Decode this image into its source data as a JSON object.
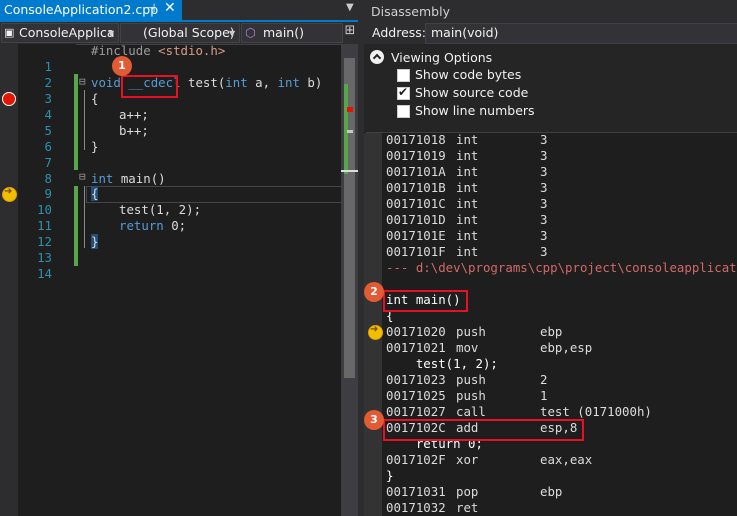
{
  "editor": {
    "tab_title": "ConsoleApplication2.cpp",
    "tab_pin": "⊣",
    "tab_close": "✕",
    "nav": {
      "project": "ConsoleApplica",
      "scope": "(Global Scope)",
      "member": "main()"
    },
    "lines": [
      {
        "n": "",
        "text": "#include <stdio.h>"
      },
      {
        "n": "1",
        "text": ""
      },
      {
        "n": "2",
        "text": ""
      },
      {
        "n": "3",
        "text": "void __cdecl test(int a, int b)"
      },
      {
        "n": "4",
        "text": "{"
      },
      {
        "n": "5",
        "text": "a++;"
      },
      {
        "n": "6",
        "text": "b++;"
      },
      {
        "n": "7",
        "text": "}"
      },
      {
        "n": "8",
        "text": ""
      },
      {
        "n": "9",
        "text": "int main()"
      },
      {
        "n": "10",
        "text": "{"
      },
      {
        "n": "11",
        "text": "test(1, 2);"
      },
      {
        "n": "12",
        "text": "return 0;"
      },
      {
        "n": "13",
        "text": "}"
      },
      {
        "n": "14",
        "text": ""
      }
    ],
    "code": {
      "include_kw": "#include",
      "include_file": "<stdio.h>",
      "void_kw": "void",
      "cdecl": "__cdecl",
      "test_sig": " test(",
      "int1": "int",
      "a": " a, ",
      "int2": "int",
      "b": " b)",
      "brace_open": "{",
      "a_inc": "a++;",
      "b_inc": "b++;",
      "brace_close": "}",
      "main_kw": "int",
      "main_rest": " main()",
      "brace_open2": "{",
      "call": "test(1, 2);",
      "ret_kw": "return",
      "ret_rest": " 0;",
      "brace_close2": "}"
    }
  },
  "disasm": {
    "title": "Disassembly",
    "address_label": "Address:",
    "address_value": "main(void)",
    "options_header": "Viewing Options",
    "options": [
      {
        "label": "Show code bytes",
        "checked": false
      },
      {
        "label": "Show source code",
        "checked": true
      },
      {
        "label": "Show line numbers",
        "checked": false
      }
    ],
    "int3_rows": [
      {
        "addr": "00171018",
        "mn": "int",
        "op": "3"
      },
      {
        "addr": "00171019",
        "mn": "int",
        "op": "3"
      },
      {
        "addr": "0017101A",
        "mn": "int",
        "op": "3"
      },
      {
        "addr": "0017101B",
        "mn": "int",
        "op": "3"
      },
      {
        "addr": "0017101C",
        "mn": "int",
        "op": "3"
      },
      {
        "addr": "0017101D",
        "mn": "int",
        "op": "3"
      },
      {
        "addr": "0017101E",
        "mn": "int",
        "op": "3"
      },
      {
        "addr": "0017101F",
        "mn": "int",
        "op": "3"
      }
    ],
    "file_line": "--- d:\\dev\\programs\\cpp\\project\\consoleapplication",
    "src_main": "int main()",
    "src_brace": "{",
    "r_push_ebp": {
      "addr": "00171020",
      "mn": "push",
      "op": "ebp"
    },
    "r_mov": {
      "addr": "00171021",
      "mn": "mov",
      "op": "ebp,esp"
    },
    "src_call": "    test(1, 2);",
    "r_push2": {
      "addr": "00171023",
      "mn": "push",
      "op": "2"
    },
    "r_push1": {
      "addr": "00171025",
      "mn": "push",
      "op": "1"
    },
    "r_call": {
      "addr": "00171027",
      "mn": "call",
      "op": "test (0171000h)"
    },
    "r_add": {
      "addr": "0017102C",
      "mn": "add",
      "op": "esp,8"
    },
    "src_ret": "    return 0;",
    "r_xor": {
      "addr": "0017102F",
      "mn": "xor",
      "op": "eax,eax"
    },
    "src_close": "}",
    "r_pop": {
      "addr": "00171031",
      "mn": "pop",
      "op": "ebp"
    },
    "r_ret": {
      "addr": "00171032",
      "mn": "ret",
      "op": ""
    }
  },
  "annotations": [
    "1",
    "2",
    "3"
  ],
  "colors": {
    "accent": "#007acc",
    "annotation_red": "#e81123",
    "badge": "#e35b34",
    "keyword": "#569cd6",
    "line_number": "#2b91af"
  }
}
